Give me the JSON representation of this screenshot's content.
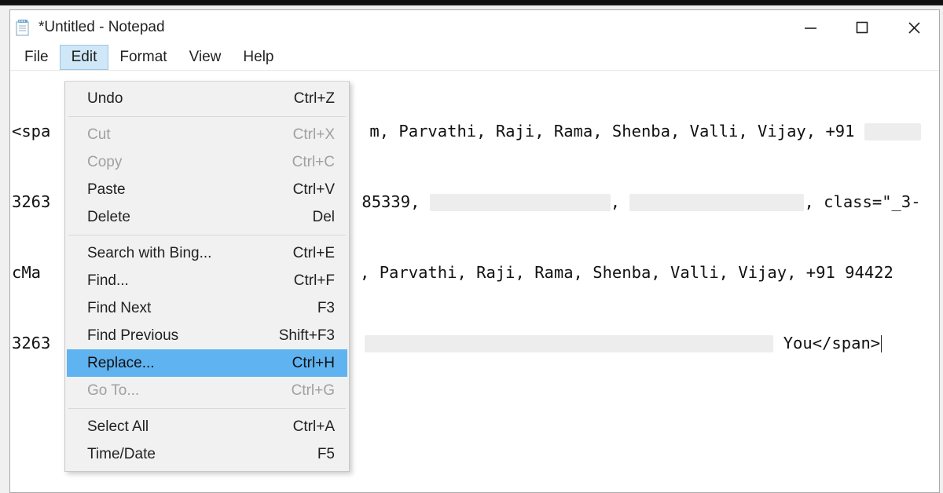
{
  "window": {
    "title": "*Untitled - Notepad"
  },
  "menubar": {
    "items": [
      {
        "label": "File"
      },
      {
        "label": "Edit"
      },
      {
        "label": "Format"
      },
      {
        "label": "View"
      },
      {
        "label": "Help"
      }
    ],
    "active_index": 1
  },
  "editor": {
    "lines": {
      "l1a": "<spa",
      "l1b": "m, Parvathi, Raji, Rama, Shenba, Valli, Vijay, +91 ",
      "l2a": "3263",
      "l2b": "85339,",
      "l2c": " class=\"_3-",
      "l3a": "cMa",
      "l3b": ", Parvathi, Raji, Rama, Shenba, Valli, Vijay, +91 94422",
      "l4a": "3263",
      "l4b": "You</span>"
    }
  },
  "dropdown": {
    "items": [
      {
        "label": "Undo",
        "shortcut": "Ctrl+Z",
        "disabled": false
      },
      {
        "sep": true
      },
      {
        "label": "Cut",
        "shortcut": "Ctrl+X",
        "disabled": true
      },
      {
        "label": "Copy",
        "shortcut": "Ctrl+C",
        "disabled": true
      },
      {
        "label": "Paste",
        "shortcut": "Ctrl+V",
        "disabled": false
      },
      {
        "label": "Delete",
        "shortcut": "Del",
        "disabled": false
      },
      {
        "sep": true
      },
      {
        "label": "Search with Bing...",
        "shortcut": "Ctrl+E",
        "disabled": false
      },
      {
        "label": "Find...",
        "shortcut": "Ctrl+F",
        "disabled": false
      },
      {
        "label": "Find Next",
        "shortcut": "F3",
        "disabled": false
      },
      {
        "label": "Find Previous",
        "shortcut": "Shift+F3",
        "disabled": false
      },
      {
        "label": "Replace...",
        "shortcut": "Ctrl+H",
        "disabled": false,
        "highlight": true
      },
      {
        "label": "Go To...",
        "shortcut": "Ctrl+G",
        "disabled": true
      },
      {
        "sep": true
      },
      {
        "label": "Select All",
        "shortcut": "Ctrl+A",
        "disabled": false
      },
      {
        "label": "Time/Date",
        "shortcut": "F5",
        "disabled": false
      }
    ]
  }
}
